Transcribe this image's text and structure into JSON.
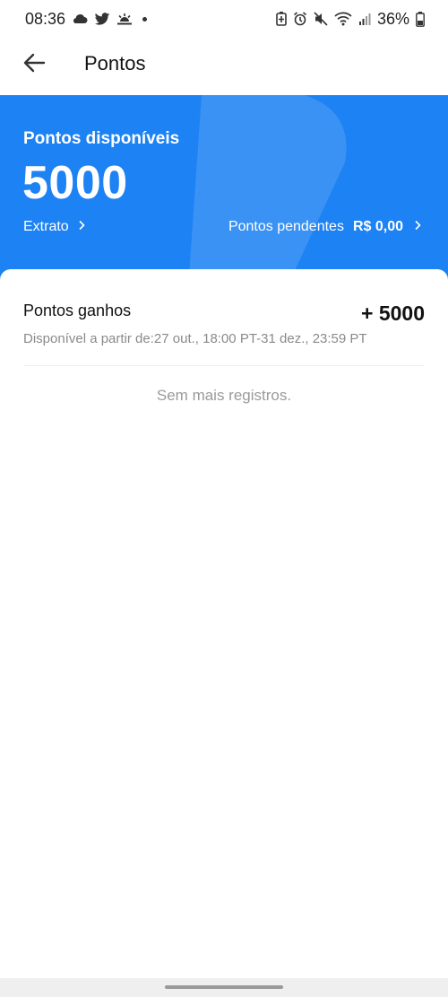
{
  "status_bar": {
    "time": "08:36",
    "battery": "36%",
    "left_icons": [
      "cloud-icon",
      "twitter-icon",
      "sunrise-icon",
      "dot-icon"
    ],
    "right_icons": [
      "battery-saver-icon",
      "alarm-icon",
      "mute-icon",
      "wifi-icon",
      "signal-icon",
      "battery-icon"
    ]
  },
  "header": {
    "title": "Pontos",
    "back_icon": "arrow-left-icon"
  },
  "summary": {
    "label": "Pontos disponíveis",
    "value": "5000",
    "extrato_label": "Extrato",
    "pending_label": "Pontos pendentes",
    "pending_amount": "R$ 0,00",
    "background_color": "#1d82f3"
  },
  "records": [
    {
      "title": "Pontos ganhos",
      "points": "+ 5000",
      "availability": "Disponível a partir de:27 out., 18:00 PT-31 dez., 23:59 PT"
    }
  ],
  "empty_text": "Sem mais registros."
}
